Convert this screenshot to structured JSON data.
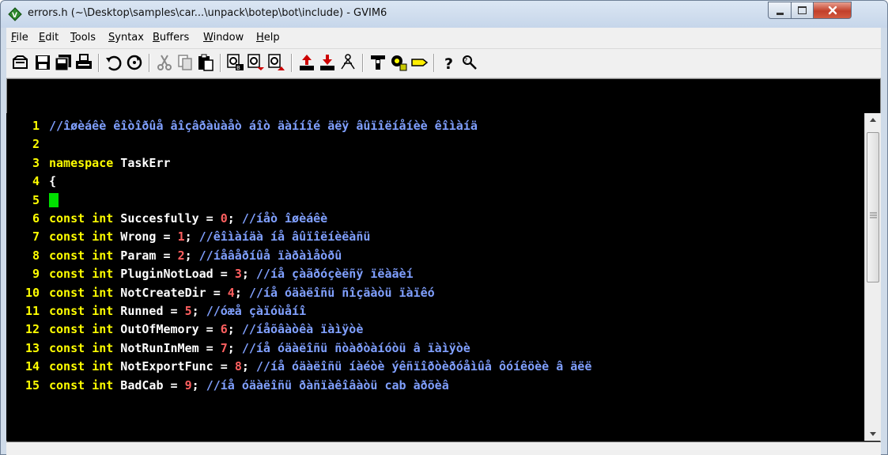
{
  "window": {
    "title": "errors.h (~\\Desktop\\samples\\car...\\unpack\\botep\\bot\\include) - GVIM6"
  },
  "menu": {
    "items": [
      {
        "label": "File",
        "accel": "F",
        "rest": "ile"
      },
      {
        "label": "Edit",
        "accel": "E",
        "rest": "dit"
      },
      {
        "label": "Tools",
        "accel": "T",
        "rest": "ools"
      },
      {
        "label": "Syntax",
        "accel": "S",
        "rest": "yntax"
      },
      {
        "label": "Buffers",
        "accel": "B",
        "rest": "uffers"
      },
      {
        "label": "Window",
        "accel": "W",
        "rest": "indow"
      },
      {
        "label": "Help",
        "accel": "H",
        "rest": "elp"
      }
    ]
  },
  "toolbar": {
    "icons": [
      "open-icon",
      "save-icon",
      "save-all-icon",
      "print-icon",
      "undo-icon",
      "redo-icon",
      "cut-icon",
      "copy-icon",
      "paste-icon",
      "find-replace-icon",
      "find-next-icon",
      "find-previous-icon",
      "load-session-icon",
      "save-session-icon",
      "run-script-icon",
      "make-icon",
      "run-shell-icon",
      "tag-jump-icon",
      "help-icon",
      "find-help-icon"
    ]
  },
  "editor": {
    "lines": [
      {
        "n": "1",
        "parts": [
          {
            "t": "cm",
            "s": "//îøèáêè êîòîðûå âîçâðàùàåò áîò äàííîé äëÿ âûïîëíåíèè êîìàíä"
          }
        ]
      },
      {
        "n": "2",
        "parts": []
      },
      {
        "n": "3",
        "parts": [
          {
            "t": "kw",
            "s": "namespace"
          },
          {
            "t": "id",
            "s": " TaskErr"
          }
        ]
      },
      {
        "n": "4",
        "parts": [
          {
            "t": "id",
            "s": "{"
          }
        ]
      },
      {
        "n": "5",
        "parts": [],
        "cursor": true
      },
      {
        "n": "6",
        "parts": [
          {
            "t": "kw",
            "s": "const"
          },
          {
            "t": "id",
            "s": " "
          },
          {
            "t": "kw",
            "s": "int"
          },
          {
            "t": "id",
            "s": " Succesfully = "
          },
          {
            "t": "num",
            "s": "0"
          },
          {
            "t": "id",
            "s": "; "
          },
          {
            "t": "cm",
            "s": "//íåò îøèáêè"
          }
        ]
      },
      {
        "n": "7",
        "parts": [
          {
            "t": "kw",
            "s": "const"
          },
          {
            "t": "id",
            "s": " "
          },
          {
            "t": "kw",
            "s": "int"
          },
          {
            "t": "id",
            "s": " Wrong = "
          },
          {
            "t": "num",
            "s": "1"
          },
          {
            "t": "id",
            "s": "; "
          },
          {
            "t": "cm",
            "s": "//êîìàíäà íå âûïîëíèëàñü"
          }
        ]
      },
      {
        "n": "8",
        "parts": [
          {
            "t": "kw",
            "s": "const"
          },
          {
            "t": "id",
            "s": " "
          },
          {
            "t": "kw",
            "s": "int"
          },
          {
            "t": "id",
            "s": " Param = "
          },
          {
            "t": "num",
            "s": "2"
          },
          {
            "t": "id",
            "s": "; "
          },
          {
            "t": "cm",
            "s": "//íåâåðíûå ïàðàìåòðû"
          }
        ]
      },
      {
        "n": "9",
        "parts": [
          {
            "t": "kw",
            "s": "const"
          },
          {
            "t": "id",
            "s": " "
          },
          {
            "t": "kw",
            "s": "int"
          },
          {
            "t": "id",
            "s": " PluginNotLoad = "
          },
          {
            "t": "num",
            "s": "3"
          },
          {
            "t": "id",
            "s": "; "
          },
          {
            "t": "cm",
            "s": "//íå çàãðóçèëñÿ ïëàãèí"
          }
        ]
      },
      {
        "n": "10",
        "parts": [
          {
            "t": "kw",
            "s": "const"
          },
          {
            "t": "id",
            "s": " "
          },
          {
            "t": "kw",
            "s": "int"
          },
          {
            "t": "id",
            "s": " NotCreateDir = "
          },
          {
            "t": "num",
            "s": "4"
          },
          {
            "t": "id",
            "s": "; "
          },
          {
            "t": "cm",
            "s": "//íå óäàëîñü ñîçäàòü ïàïêó"
          }
        ]
      },
      {
        "n": "11",
        "parts": [
          {
            "t": "kw",
            "s": "const"
          },
          {
            "t": "id",
            "s": " "
          },
          {
            "t": "kw",
            "s": "int"
          },
          {
            "t": "id",
            "s": " Runned = "
          },
          {
            "t": "num",
            "s": "5"
          },
          {
            "t": "id",
            "s": "; "
          },
          {
            "t": "cm",
            "s": "//óæå çàïóùåíî"
          }
        ]
      },
      {
        "n": "12",
        "parts": [
          {
            "t": "kw",
            "s": "const"
          },
          {
            "t": "id",
            "s": " "
          },
          {
            "t": "kw",
            "s": "int"
          },
          {
            "t": "id",
            "s": " OutOfMemory = "
          },
          {
            "t": "num",
            "s": "6"
          },
          {
            "t": "id",
            "s": "; "
          },
          {
            "t": "cm",
            "s": "//íåõâàòêà ïàìÿòè"
          }
        ]
      },
      {
        "n": "13",
        "parts": [
          {
            "t": "kw",
            "s": "const"
          },
          {
            "t": "id",
            "s": " "
          },
          {
            "t": "kw",
            "s": "int"
          },
          {
            "t": "id",
            "s": " NotRunInMem = "
          },
          {
            "t": "num",
            "s": "7"
          },
          {
            "t": "id",
            "s": "; "
          },
          {
            "t": "cm",
            "s": "//íå óäàëîñü ñòàðòàíóòü â ïàìÿòè"
          }
        ]
      },
      {
        "n": "14",
        "parts": [
          {
            "t": "kw",
            "s": "const"
          },
          {
            "t": "id",
            "s": " "
          },
          {
            "t": "kw",
            "s": "int"
          },
          {
            "t": "id",
            "s": " NotExportFunc = "
          },
          {
            "t": "num",
            "s": "8"
          },
          {
            "t": "id",
            "s": "; "
          },
          {
            "t": "cm",
            "s": "//íå óäàëîñü íàéòè ýêñïîðòèðóåìûå ôóíêöèè â äëë"
          }
        ]
      },
      {
        "n": "15",
        "parts": [
          {
            "t": "kw",
            "s": "const"
          },
          {
            "t": "id",
            "s": " "
          },
          {
            "t": "kw",
            "s": "int"
          },
          {
            "t": "id",
            "s": " BadCab = "
          },
          {
            "t": "num",
            "s": "9"
          },
          {
            "t": "id",
            "s": "; "
          },
          {
            "t": "cm",
            "s": "//íå óäàëîñü ðàñïàêîâàòü cab àðõèâ"
          }
        ]
      }
    ]
  },
  "colors": {
    "line_number": "#ffff00",
    "keyword": "#ffff00",
    "identifier": "#ffffff",
    "number": "#ff6060",
    "comment": "#80a0ff",
    "cursor": "#00e000",
    "editor_bg": "#000000"
  }
}
